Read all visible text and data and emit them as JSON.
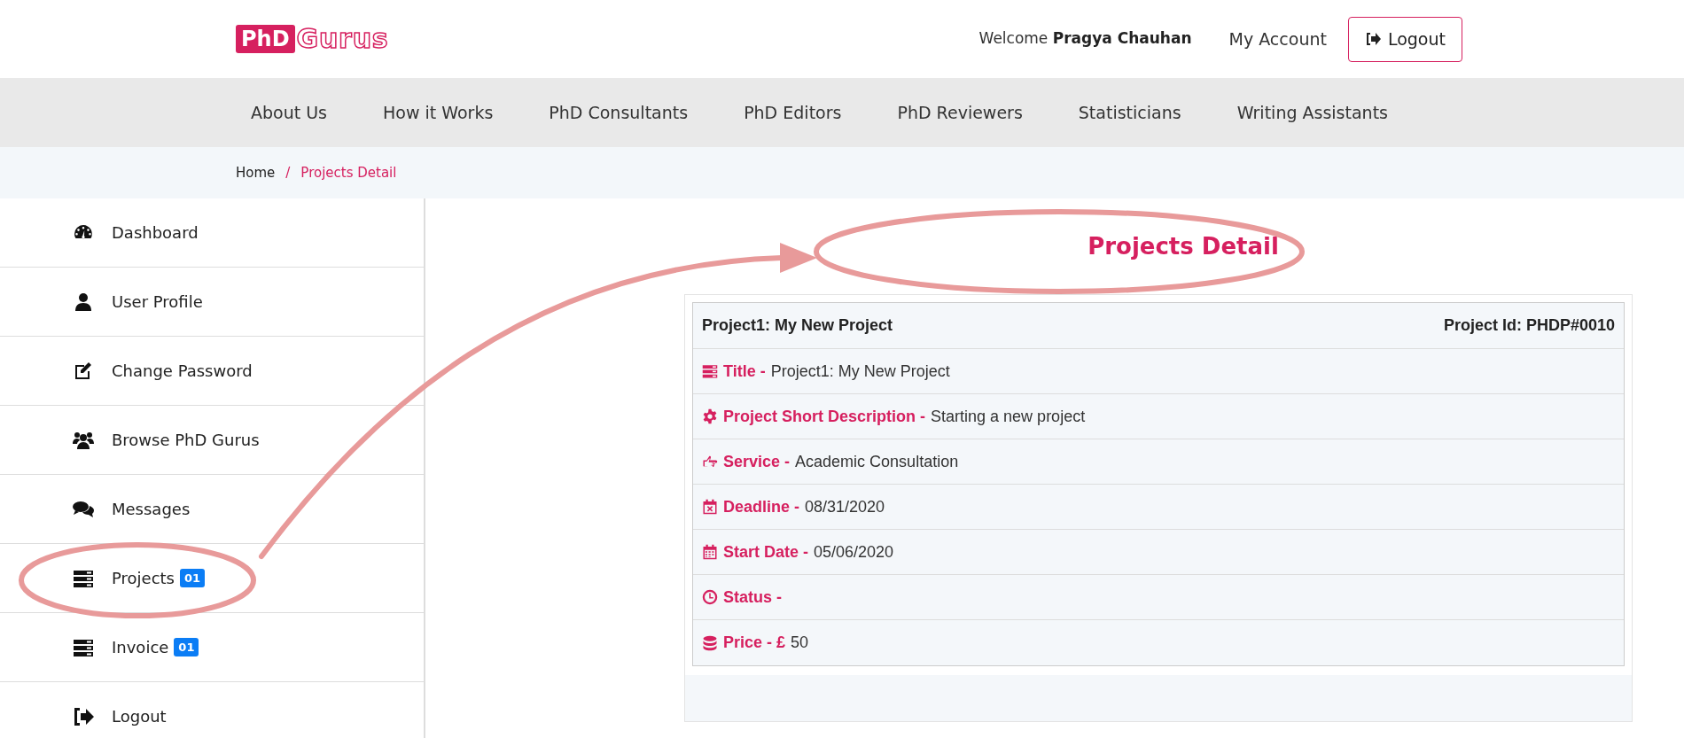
{
  "logo": {
    "mark": "PhD",
    "name": "Gurus"
  },
  "header": {
    "welcome": "Welcome",
    "user": "Pragya Chauhan",
    "account": "My Account",
    "logout": "Logout"
  },
  "nav": [
    "About Us",
    "How it Works",
    "PhD Consultants",
    "PhD Editors",
    "PhD Reviewers",
    "Statisticians",
    "Writing Assistants"
  ],
  "breadcrumb": {
    "home": "Home",
    "separator": "/",
    "current": "Projects Detail"
  },
  "sidebar": {
    "items": [
      {
        "kind": "dashboard",
        "label": "Dashboard"
      },
      {
        "kind": "user",
        "label": "User Profile"
      },
      {
        "kind": "edit",
        "label": "Change Password"
      },
      {
        "kind": "users",
        "label": "Browse PhD Gurus"
      },
      {
        "kind": "messages",
        "label": "Messages"
      },
      {
        "kind": "list",
        "label": "Projects",
        "badge": "01"
      },
      {
        "kind": "list",
        "label": "Invoice",
        "badge": "01"
      },
      {
        "kind": "logout",
        "label": "Logout"
      }
    ]
  },
  "page_title": "Projects Detail",
  "project": {
    "name": "Project1: My New Project",
    "id": "Project Id: PHDP#0010",
    "fields": [
      {
        "kind": "list",
        "label": "Title -",
        "value": "Project1: My New Project"
      },
      {
        "kind": "gear",
        "label": "Project Short Description -",
        "value": "Starting a new project"
      },
      {
        "kind": "hand",
        "label": "Service -",
        "value": "Academic Consultation"
      },
      {
        "kind": "calendar-x",
        "label": "Deadline -",
        "value": "08/31/2020"
      },
      {
        "kind": "calendar",
        "label": "Start Date -",
        "value": "05/06/2020"
      },
      {
        "kind": "clock",
        "label": "Status -"
      },
      {
        "kind": "coins",
        "label": "Price - £",
        "value": "50"
      }
    ]
  }
}
